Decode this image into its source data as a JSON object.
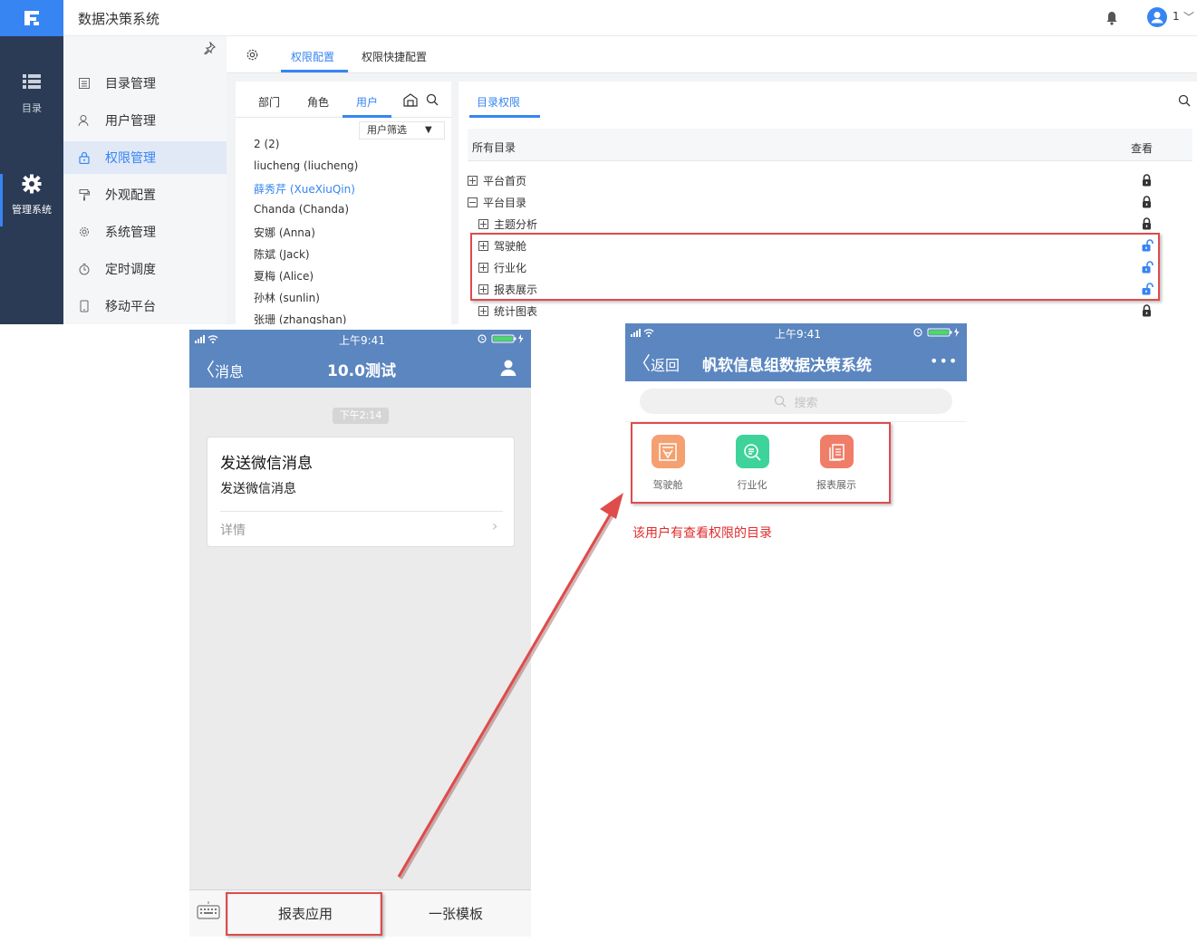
{
  "admin": {
    "app_title": "数据决策系统",
    "user_number": "1",
    "leftnav": [
      {
        "label": "目录",
        "icon": "list-icon"
      },
      {
        "label": "管理系统",
        "icon": "gear-icon",
        "active": true
      }
    ],
    "submenu": [
      {
        "label": "目录管理",
        "icon": "catalog-icon"
      },
      {
        "label": "用户管理",
        "icon": "user-icon"
      },
      {
        "label": "权限管理",
        "icon": "lock-icon",
        "active": true
      },
      {
        "label": "外观配置",
        "icon": "paint-roller-icon"
      },
      {
        "label": "系统管理",
        "icon": "settings-icon"
      },
      {
        "label": "定时调度",
        "icon": "timer-icon"
      },
      {
        "label": "移动平台",
        "icon": "mobile-icon"
      }
    ],
    "tabs": {
      "config": "权限配置",
      "quick_config": "权限快捷配置"
    },
    "user_panel": {
      "tabs": [
        "部门",
        "角色",
        "用户"
      ],
      "filter_label": "用户筛选",
      "users": [
        "2 (2)",
        "liucheng (liucheng)",
        "薛秀芹 (XueXiuQin)",
        "Chanda (Chanda)",
        "安娜 (Anna)",
        "陈斌 (Jack)",
        "夏梅 (Alice)",
        "孙林 (sunlin)",
        "张珊 (zhangshan)"
      ],
      "selected_user": "薛秀芹 (XueXiuQin)"
    },
    "perm_panel": {
      "tab": "目录权限",
      "header_all": "所有目录",
      "header_view": "查看",
      "tree": [
        {
          "label": "平台首页",
          "expander": "plus",
          "lock": "locked"
        },
        {
          "label": "平台目录",
          "expander": "minus",
          "lock": "locked"
        },
        {
          "label": "主题分析",
          "expander": "plus",
          "lock": "locked"
        },
        {
          "label": "驾驶舱",
          "expander": "plus",
          "lock": "unlocked"
        },
        {
          "label": "行业化",
          "expander": "plus",
          "lock": "unlocked"
        },
        {
          "label": "报表展示",
          "expander": "plus",
          "lock": "unlocked"
        },
        {
          "label": "统计图表",
          "expander": "plus",
          "lock": "locked"
        }
      ]
    }
  },
  "phone1": {
    "status_time": "上午9:41",
    "back_label": "消息",
    "title": "10.0测试",
    "msg_time": "下午2:14",
    "card_title": "发送微信消息",
    "card_body": "发送微信消息",
    "card_detail": "详情",
    "bottom_menu": [
      "报表应用",
      "一张模板"
    ]
  },
  "phone2": {
    "status_time": "上午9:41",
    "back_label": "返回",
    "title": "帆软信息组数据决策系统",
    "more": "•••",
    "search_placeholder": "搜索",
    "apps": [
      {
        "label": "驾驶舱",
        "color": "#f5a070",
        "icon": "cockpit-icon"
      },
      {
        "label": "行业化",
        "color": "#3dd39a",
        "icon": "search-report-icon"
      },
      {
        "label": "报表展示",
        "color": "#f07d68",
        "icon": "report-icon"
      }
    ]
  },
  "caption": "该用户有查看权限的目录",
  "colors": {
    "accent": "#3685f2",
    "nav_dark": "#2b3b55",
    "phone_header": "#5b86c0",
    "annotation_red": "#e04b4b"
  }
}
